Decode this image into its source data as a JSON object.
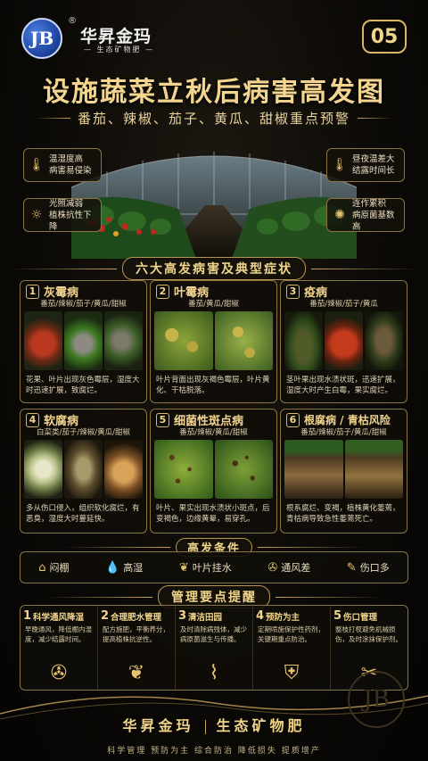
{
  "header": {
    "brand": "华昇金玛",
    "brand_sub": "生态矿物肥",
    "reg": "®",
    "logo_text": "JB",
    "issue_number": "05",
    "title": "设施蔬菜立秋后病害高发图",
    "subtitle": "番茄、辣椒、茄子、黄瓜、甜椒重点预警"
  },
  "callouts": [
    {
      "icon": "thermometer-drop-icon",
      "text": "温湿度高\n病害易侵染"
    },
    {
      "icon": "sun-icon",
      "text": "光照减弱\n植株抗性下降"
    },
    {
      "icon": "thermometer-icon",
      "text": "昼夜温差大\n结露时间长"
    },
    {
      "icon": "germ-icon",
      "text": "连作累积\n病原菌基数高"
    }
  ],
  "section_diseases": "六大高发病害及典型症状",
  "diseases": [
    {
      "no": "1",
      "name": "灰霉病",
      "crops": "番茄/辣椒/茄子/黄瓜/甜椒",
      "desc": "花果、叶片出现灰色霉层，湿度大时迅速扩展，致腐烂。"
    },
    {
      "no": "2",
      "name": "叶霉病",
      "crops": "番茄/黄瓜/甜椒",
      "desc": "叶片背面出现灰褐色霉层，叶片黄化、干枯脱落。"
    },
    {
      "no": "3",
      "name": "疫病",
      "crops": "番茄/辣椒/茄子/黄瓜",
      "desc": "茎叶果出现水渍状斑，迅速扩展，湿度大时产生白霉，果实腐烂。"
    },
    {
      "no": "4",
      "name": "软腐病",
      "crops": "白菜类/茄子/辣椒/黄瓜/甜椒",
      "desc": "多从伤口侵入，组织软化腐烂，有恶臭，湿度大时蔓延快。"
    },
    {
      "no": "5",
      "name": "细菌性斑点病",
      "crops": "番茄/辣椒/黄瓜/甜椒",
      "desc": "叶片、果实出现水渍状小斑点，后变褐色，边缘黄晕，易穿孔。"
    },
    {
      "no": "6",
      "name": "根腐病 / 青枯风险",
      "crops": "番茄/辣椒/茄子/黄瓜/甜椒",
      "desc": "根系腐烂、变褐，植株黄化萎蔫，青枯病导致急性萎蔫死亡。"
    }
  ],
  "section_conditions": "高发条件",
  "conditions": [
    {
      "icon": "greenhouse-icon",
      "label": "闷棚"
    },
    {
      "icon": "humidity-icon",
      "label": "高湿"
    },
    {
      "icon": "leaf-water-icon",
      "label": "叶片挂水"
    },
    {
      "icon": "fan-icon",
      "label": "通风差"
    },
    {
      "icon": "knife-icon",
      "label": "伤口多"
    }
  ],
  "section_management": "管理要点提醒",
  "management": [
    {
      "no": "1",
      "title": "科学通风降湿",
      "desc": "早晚通风，降低棚内湿度，减少结露时间。",
      "icon": "fan-icon"
    },
    {
      "no": "2",
      "title": "合理肥水管理",
      "desc": "配方施肥，平衡养分，提高植株抗逆性。",
      "icon": "water-drop-leaf-icon"
    },
    {
      "no": "3",
      "title": "清洁田园",
      "desc": "及时清除病残体，减少病原菌滋生与传播。",
      "icon": "broom-icon"
    },
    {
      "no": "4",
      "title": "预防为主",
      "desc": "定期喷施保护性药剂，关键期重点防治。",
      "icon": "shield-icon"
    },
    {
      "no": "5",
      "title": "伤口管理",
      "desc": "整枝打杈避免机械损伤，及时涂抹保护剂。",
      "icon": "scissors-icon"
    }
  ],
  "footer": {
    "brand": "华昇金玛",
    "product": "生态矿物肥",
    "slogan": "科学管理  预防为主  综合防治  降低损失  提质增产"
  },
  "colors": {
    "gold": "#e6c370",
    "bg": "#0b0906",
    "border": "#8b7444"
  }
}
